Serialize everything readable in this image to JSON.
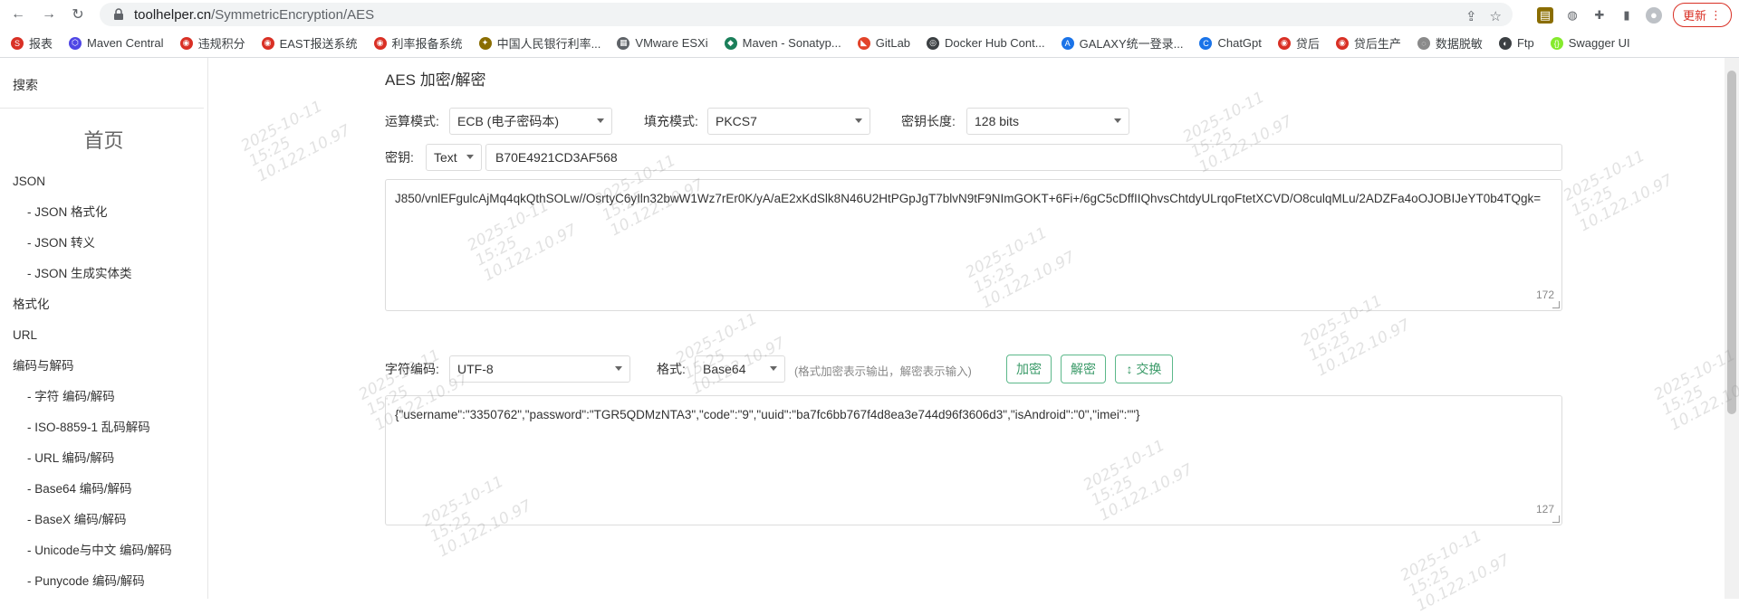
{
  "browser": {
    "url_host": "toolhelper.cn",
    "url_path": "/SymmetricEncryption/AES",
    "update_label": "更新",
    "bookmarks": [
      {
        "label": "报表",
        "color": "#d93025",
        "glyph": "S"
      },
      {
        "label": "Maven Central",
        "color": "#4f46e5",
        "glyph": "⬡"
      },
      {
        "label": "违规积分",
        "color": "#d93025",
        "glyph": "◉"
      },
      {
        "label": "EAST报送系统",
        "color": "#d93025",
        "glyph": "◉"
      },
      {
        "label": "利率报备系统",
        "color": "#d93025",
        "glyph": "◉"
      },
      {
        "label": "中国人民银行利率...",
        "color": "#8a6d00",
        "glyph": "✦"
      },
      {
        "label": "VMware ESXi",
        "color": "#5f6368",
        "glyph": "▦"
      },
      {
        "label": "Maven - Sonatyp...",
        "color": "#1b7f5a",
        "glyph": "◆"
      },
      {
        "label": "GitLab",
        "color": "#e24329",
        "glyph": "◣"
      },
      {
        "label": "Docker Hub Cont...",
        "color": "#3c4043",
        "glyph": "◎"
      },
      {
        "label": "GALAXY统一登录...",
        "color": "#1a73e8",
        "glyph": "A"
      },
      {
        "label": "ChatGpt",
        "color": "#1a73e8",
        "glyph": "C"
      },
      {
        "label": "贷后",
        "color": "#d93025",
        "glyph": "◉"
      },
      {
        "label": "贷后生产",
        "color": "#d93025",
        "glyph": "◉"
      },
      {
        "label": "数据脱敏",
        "color": "#8a8a8a",
        "glyph": "◌"
      },
      {
        "label": "Ftp",
        "color": "#3c4043",
        "glyph": "◐"
      },
      {
        "label": "Swagger UI",
        "color": "#85ea2d",
        "glyph": "{}"
      }
    ]
  },
  "sidebar": {
    "search_label": "搜索",
    "home_label": "首页",
    "items": [
      {
        "label": "JSON",
        "sub": false
      },
      {
        "label": "- JSON 格式化",
        "sub": true
      },
      {
        "label": "- JSON 转义",
        "sub": true
      },
      {
        "label": "- JSON 生成实体类",
        "sub": true
      },
      {
        "label": "格式化",
        "sub": false
      },
      {
        "label": "URL",
        "sub": false
      },
      {
        "label": "编码与解码",
        "sub": false
      },
      {
        "label": "- 字符  编码/解码",
        "sub": true
      },
      {
        "label": "- ISO-8859-1 乱码解码",
        "sub": true
      },
      {
        "label": "- URL  编码/解码",
        "sub": true
      },
      {
        "label": "- Base64  编码/解码",
        "sub": true
      },
      {
        "label": "- BaseX  编码/解码",
        "sub": true
      },
      {
        "label": "- Unicode与中文  编码/解码",
        "sub": true
      },
      {
        "label": "- Punycode  编码/解码",
        "sub": true
      }
    ]
  },
  "main": {
    "title": "AES 加密/解密",
    "mode_label": "运算模式:",
    "mode_value": "ECB (电子密码本)",
    "padding_label": "填充模式:",
    "padding_value": "PKCS7",
    "keylen_label": "密钥长度:",
    "keylen_value": "128 bits",
    "key_label": "密钥:",
    "key_type_value": "Text",
    "key_value": "B70E4921CD3AF568",
    "cipher_text": "J850/vnlEFgulcAjMq4qkQthSOLw//OsrtyC6yIln32bwW1Wz7rEr0K/yA/aE2xKdSlk8N46U2HtPGpJgT7blvN9tF9NImGOKT+6Fi+/6gC5cDffIIQhvsChtdyULrqoFtetXCVD/O8culqMLu/2ADZFa4oOJOBIJeYT0b4TQgk=",
    "cipher_count": "172",
    "charset_label": "字符编码:",
    "charset_value": "UTF-8",
    "format_label": "格式:",
    "format_value": "Base64",
    "format_hint": "(格式加密表示输出，解密表示输入)",
    "encrypt_label": "加密",
    "decrypt_label": "解密",
    "swap_label": "↕ 交换",
    "plain_text": "{\"username\":\"3350762\",\"password\":\"TGR5QDMzNTA3\",\"code\":\"9\",\"uuid\":\"ba7fc6bb767f4d8ea3e744d96f3606d3\",\"isAndroid\":\"0\",\"imei\":\"\"}",
    "plain_count": "127"
  },
  "watermark": {
    "line1": "2025-10-11",
    "line2": "15:25",
    "line3": "10.122.10.97"
  }
}
